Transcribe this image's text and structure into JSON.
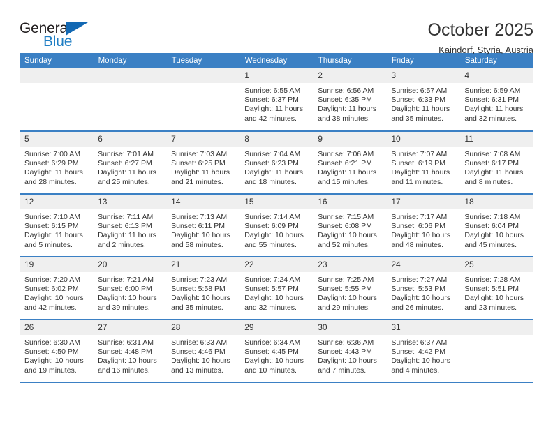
{
  "brand": {
    "name_top": "General",
    "name_bottom": "Blue",
    "triangle_color": "#1268b3",
    "blue_text_color": "#1f7ec4"
  },
  "header": {
    "month_title": "October 2025",
    "location": "Kaindorf, Styria, Austria",
    "header_bg": "#3b80c4",
    "daynum_bg": "#efefef"
  },
  "weekday_headers": [
    "Sunday",
    "Monday",
    "Tuesday",
    "Wednesday",
    "Thursday",
    "Friday",
    "Saturday"
  ],
  "weeks": [
    [
      {
        "day": "",
        "sunrise": "",
        "sunset": "",
        "daylight1": "",
        "daylight2": ""
      },
      {
        "day": "",
        "sunrise": "",
        "sunset": "",
        "daylight1": "",
        "daylight2": ""
      },
      {
        "day": "",
        "sunrise": "",
        "sunset": "",
        "daylight1": "",
        "daylight2": ""
      },
      {
        "day": "1",
        "sunrise": "Sunrise: 6:55 AM",
        "sunset": "Sunset: 6:37 PM",
        "daylight1": "Daylight: 11 hours",
        "daylight2": "and 42 minutes."
      },
      {
        "day": "2",
        "sunrise": "Sunrise: 6:56 AM",
        "sunset": "Sunset: 6:35 PM",
        "daylight1": "Daylight: 11 hours",
        "daylight2": "and 38 minutes."
      },
      {
        "day": "3",
        "sunrise": "Sunrise: 6:57 AM",
        "sunset": "Sunset: 6:33 PM",
        "daylight1": "Daylight: 11 hours",
        "daylight2": "and 35 minutes."
      },
      {
        "day": "4",
        "sunrise": "Sunrise: 6:59 AM",
        "sunset": "Sunset: 6:31 PM",
        "daylight1": "Daylight: 11 hours",
        "daylight2": "and 32 minutes."
      }
    ],
    [
      {
        "day": "5",
        "sunrise": "Sunrise: 7:00 AM",
        "sunset": "Sunset: 6:29 PM",
        "daylight1": "Daylight: 11 hours",
        "daylight2": "and 28 minutes."
      },
      {
        "day": "6",
        "sunrise": "Sunrise: 7:01 AM",
        "sunset": "Sunset: 6:27 PM",
        "daylight1": "Daylight: 11 hours",
        "daylight2": "and 25 minutes."
      },
      {
        "day": "7",
        "sunrise": "Sunrise: 7:03 AM",
        "sunset": "Sunset: 6:25 PM",
        "daylight1": "Daylight: 11 hours",
        "daylight2": "and 21 minutes."
      },
      {
        "day": "8",
        "sunrise": "Sunrise: 7:04 AM",
        "sunset": "Sunset: 6:23 PM",
        "daylight1": "Daylight: 11 hours",
        "daylight2": "and 18 minutes."
      },
      {
        "day": "9",
        "sunrise": "Sunrise: 7:06 AM",
        "sunset": "Sunset: 6:21 PM",
        "daylight1": "Daylight: 11 hours",
        "daylight2": "and 15 minutes."
      },
      {
        "day": "10",
        "sunrise": "Sunrise: 7:07 AM",
        "sunset": "Sunset: 6:19 PM",
        "daylight1": "Daylight: 11 hours",
        "daylight2": "and 11 minutes."
      },
      {
        "day": "11",
        "sunrise": "Sunrise: 7:08 AM",
        "sunset": "Sunset: 6:17 PM",
        "daylight1": "Daylight: 11 hours",
        "daylight2": "and 8 minutes."
      }
    ],
    [
      {
        "day": "12",
        "sunrise": "Sunrise: 7:10 AM",
        "sunset": "Sunset: 6:15 PM",
        "daylight1": "Daylight: 11 hours",
        "daylight2": "and 5 minutes."
      },
      {
        "day": "13",
        "sunrise": "Sunrise: 7:11 AM",
        "sunset": "Sunset: 6:13 PM",
        "daylight1": "Daylight: 11 hours",
        "daylight2": "and 2 minutes."
      },
      {
        "day": "14",
        "sunrise": "Sunrise: 7:13 AM",
        "sunset": "Sunset: 6:11 PM",
        "daylight1": "Daylight: 10 hours",
        "daylight2": "and 58 minutes."
      },
      {
        "day": "15",
        "sunrise": "Sunrise: 7:14 AM",
        "sunset": "Sunset: 6:09 PM",
        "daylight1": "Daylight: 10 hours",
        "daylight2": "and 55 minutes."
      },
      {
        "day": "16",
        "sunrise": "Sunrise: 7:15 AM",
        "sunset": "Sunset: 6:08 PM",
        "daylight1": "Daylight: 10 hours",
        "daylight2": "and 52 minutes."
      },
      {
        "day": "17",
        "sunrise": "Sunrise: 7:17 AM",
        "sunset": "Sunset: 6:06 PM",
        "daylight1": "Daylight: 10 hours",
        "daylight2": "and 48 minutes."
      },
      {
        "day": "18",
        "sunrise": "Sunrise: 7:18 AM",
        "sunset": "Sunset: 6:04 PM",
        "daylight1": "Daylight: 10 hours",
        "daylight2": "and 45 minutes."
      }
    ],
    [
      {
        "day": "19",
        "sunrise": "Sunrise: 7:20 AM",
        "sunset": "Sunset: 6:02 PM",
        "daylight1": "Daylight: 10 hours",
        "daylight2": "and 42 minutes."
      },
      {
        "day": "20",
        "sunrise": "Sunrise: 7:21 AM",
        "sunset": "Sunset: 6:00 PM",
        "daylight1": "Daylight: 10 hours",
        "daylight2": "and 39 minutes."
      },
      {
        "day": "21",
        "sunrise": "Sunrise: 7:23 AM",
        "sunset": "Sunset: 5:58 PM",
        "daylight1": "Daylight: 10 hours",
        "daylight2": "and 35 minutes."
      },
      {
        "day": "22",
        "sunrise": "Sunrise: 7:24 AM",
        "sunset": "Sunset: 5:57 PM",
        "daylight1": "Daylight: 10 hours",
        "daylight2": "and 32 minutes."
      },
      {
        "day": "23",
        "sunrise": "Sunrise: 7:25 AM",
        "sunset": "Sunset: 5:55 PM",
        "daylight1": "Daylight: 10 hours",
        "daylight2": "and 29 minutes."
      },
      {
        "day": "24",
        "sunrise": "Sunrise: 7:27 AM",
        "sunset": "Sunset: 5:53 PM",
        "daylight1": "Daylight: 10 hours",
        "daylight2": "and 26 minutes."
      },
      {
        "day": "25",
        "sunrise": "Sunrise: 7:28 AM",
        "sunset": "Sunset: 5:51 PM",
        "daylight1": "Daylight: 10 hours",
        "daylight2": "and 23 minutes."
      }
    ],
    [
      {
        "day": "26",
        "sunrise": "Sunrise: 6:30 AM",
        "sunset": "Sunset: 4:50 PM",
        "daylight1": "Daylight: 10 hours",
        "daylight2": "and 19 minutes."
      },
      {
        "day": "27",
        "sunrise": "Sunrise: 6:31 AM",
        "sunset": "Sunset: 4:48 PM",
        "daylight1": "Daylight: 10 hours",
        "daylight2": "and 16 minutes."
      },
      {
        "day": "28",
        "sunrise": "Sunrise: 6:33 AM",
        "sunset": "Sunset: 4:46 PM",
        "daylight1": "Daylight: 10 hours",
        "daylight2": "and 13 minutes."
      },
      {
        "day": "29",
        "sunrise": "Sunrise: 6:34 AM",
        "sunset": "Sunset: 4:45 PM",
        "daylight1": "Daylight: 10 hours",
        "daylight2": "and 10 minutes."
      },
      {
        "day": "30",
        "sunrise": "Sunrise: 6:36 AM",
        "sunset": "Sunset: 4:43 PM",
        "daylight1": "Daylight: 10 hours",
        "daylight2": "and 7 minutes."
      },
      {
        "day": "31",
        "sunrise": "Sunrise: 6:37 AM",
        "sunset": "Sunset: 4:42 PM",
        "daylight1": "Daylight: 10 hours",
        "daylight2": "and 4 minutes."
      },
      {
        "day": "",
        "sunrise": "",
        "sunset": "",
        "daylight1": "",
        "daylight2": ""
      }
    ]
  ]
}
